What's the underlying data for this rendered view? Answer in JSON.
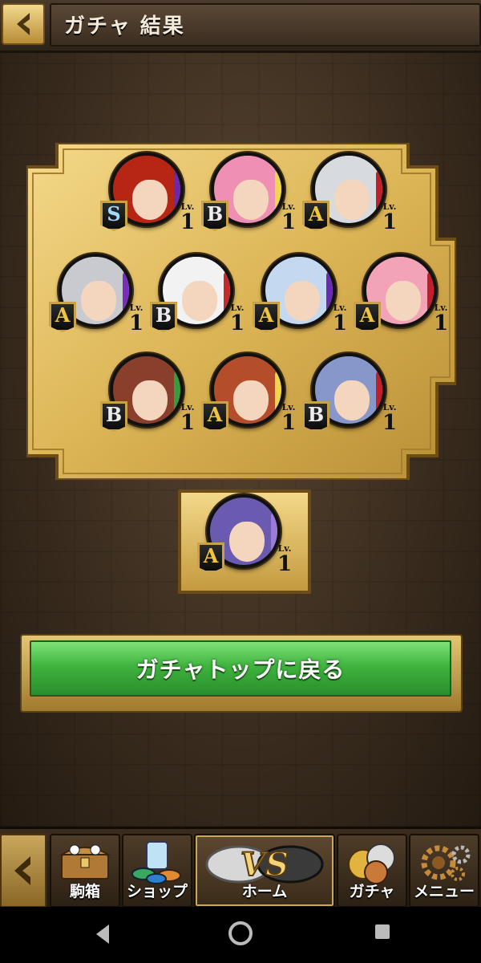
{
  "header": {
    "title": "ガチャ 結果",
    "back_icon": "chevron-left-icon"
  },
  "results": {
    "lv_label": "Lv.",
    "units": [
      {
        "rank": "S",
        "level": "1",
        "hair": "#b72614",
        "ring": "#6d2aa8"
      },
      {
        "rank": "B",
        "level": "1",
        "hair": "#f08fb4",
        "ring": "#f0d74a"
      },
      {
        "rank": "A",
        "level": "1",
        "hair": "#d7dbe0",
        "ring": "#c01e28"
      },
      {
        "rank": "A",
        "level": "1",
        "hair": "#c9c9d0",
        "ring": "#7a2dbb"
      },
      {
        "rank": "B",
        "level": "1",
        "hair": "#f2f2f2",
        "ring": "#c52a2a"
      },
      {
        "rank": "A",
        "level": "1",
        "hair": "#c4d8ef",
        "ring": "#6b2ab0"
      },
      {
        "rank": "A",
        "level": "1",
        "hair": "#f3a3b7",
        "ring": "#c01e28"
      },
      {
        "rank": "B",
        "level": "1",
        "hair": "#8a3e2c",
        "ring": "#3a9a3f"
      },
      {
        "rank": "A",
        "level": "1",
        "hair": "#b44d2a",
        "ring": "#f0d74a"
      },
      {
        "rank": "B",
        "level": "1",
        "hair": "#8797c9",
        "ring": "#c01e28"
      }
    ],
    "bonus": {
      "rank": "A",
      "level": "1",
      "hair": "#6a5ab0",
      "ring": "#9b7bd8"
    }
  },
  "return_button": {
    "label": "ガチャトップに戻る"
  },
  "nav": {
    "items": [
      {
        "label": "駒箱",
        "icon": "treasure-chest-icon"
      },
      {
        "label": "ショップ",
        "icon": "shop-coins-icon"
      },
      {
        "label": "ホーム",
        "icon": "vs-home-icon",
        "logo": "VS"
      },
      {
        "label": "ガチャ",
        "icon": "gacha-coins-icon"
      },
      {
        "label": "メニュー",
        "icon": "gear-icon"
      }
    ]
  },
  "colors": {
    "gold": "#d9b45a",
    "button_green": "#3fb43e",
    "background": "#3b2d1f"
  }
}
